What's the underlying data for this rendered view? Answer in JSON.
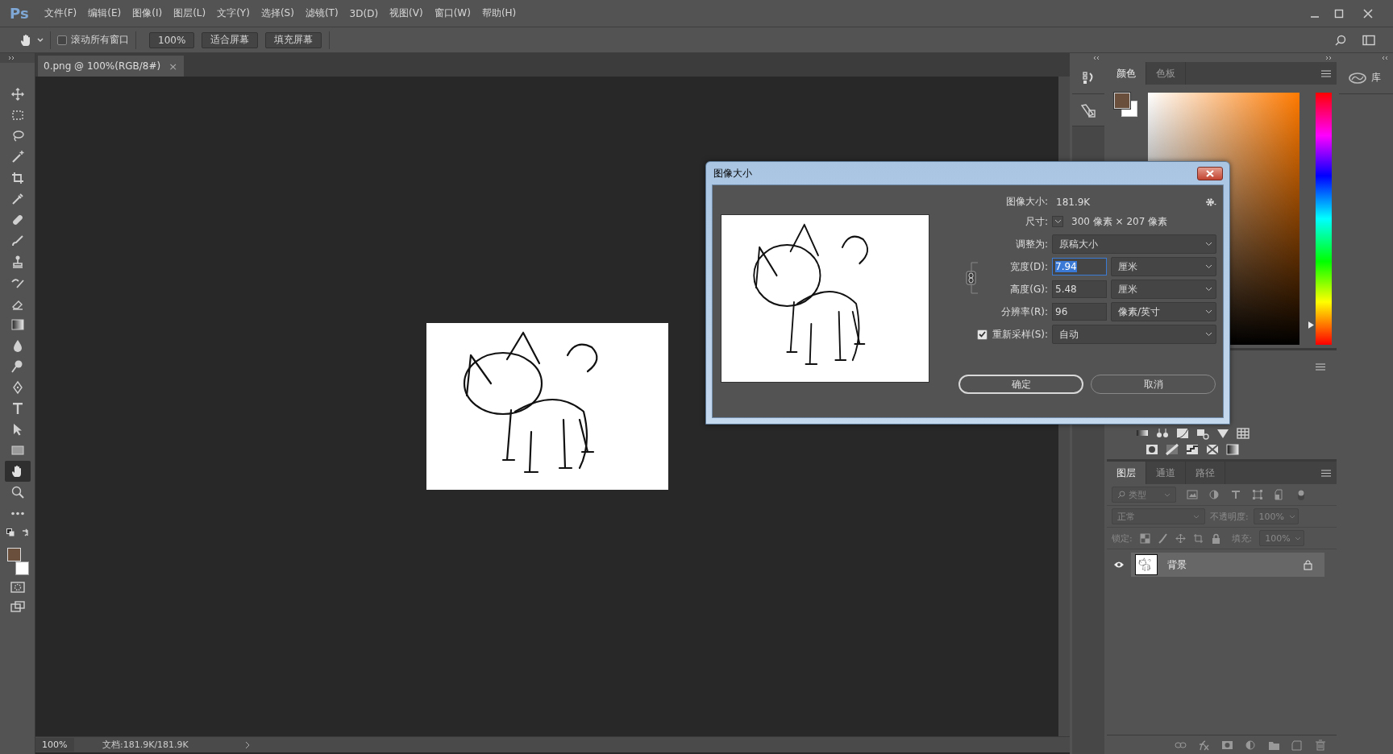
{
  "app": {
    "logo": "Ps"
  },
  "menu": [
    {
      "label": "文件(F)"
    },
    {
      "label": "编辑(E)"
    },
    {
      "label": "图像(I)"
    },
    {
      "label": "图层(L)"
    },
    {
      "label": "文字(Y)"
    },
    {
      "label": "选择(S)"
    },
    {
      "label": "滤镜(T)"
    },
    {
      "label": "3D(D)"
    },
    {
      "label": "视图(V)"
    },
    {
      "label": "窗口(W)"
    },
    {
      "label": "帮助(H)"
    }
  ],
  "options_bar": {
    "scroll_all_windows": {
      "label": "滚动所有窗口",
      "checked": false
    },
    "buttons": [
      {
        "label": "100%"
      },
      {
        "label": "适合屏幕"
      },
      {
        "label": "填充屏幕"
      }
    ]
  },
  "tools": [
    {
      "kind": "move",
      "selected": false
    },
    {
      "kind": "marquee",
      "selected": false
    },
    {
      "kind": "lasso",
      "selected": false
    },
    {
      "kind": "wand",
      "selected": false
    },
    {
      "kind": "crop",
      "selected": false
    },
    {
      "kind": "eyedropper",
      "selected": false
    },
    {
      "kind": "bandage",
      "selected": false
    },
    {
      "kind": "brush",
      "selected": false
    },
    {
      "kind": "stamp",
      "selected": false
    },
    {
      "kind": "history",
      "selected": false
    },
    {
      "kind": "eraser",
      "selected": false
    },
    {
      "kind": "gradient",
      "selected": false
    },
    {
      "kind": "drop",
      "selected": false
    },
    {
      "kind": "dodge",
      "selected": false
    },
    {
      "kind": "pen",
      "selected": false
    },
    {
      "kind": "type",
      "selected": false
    },
    {
      "kind": "pointer",
      "selected": false
    },
    {
      "kind": "rectangle",
      "selected": false
    },
    {
      "kind": "hand",
      "selected": true
    },
    {
      "kind": "zoom",
      "selected": false
    },
    {
      "kind": "more",
      "selected": false
    }
  ],
  "swatches": [
    {
      "kind": "foreground",
      "color": "#6a4f3c"
    },
    {
      "kind": "background",
      "color": "#ffffff"
    }
  ],
  "document": {
    "tab": {
      "title": "0.png @ 100%(RGB/8#)",
      "close": "×"
    }
  },
  "status_bar": {
    "zoom": "100%",
    "document_size": "文档:181.9K/181.9K"
  },
  "color_panel": {
    "tabs": [
      {
        "label": "颜色",
        "selected": true
      },
      {
        "label": "色板",
        "selected": false
      }
    ],
    "hue_slider": {
      "level": 0.08
    }
  },
  "library_panel": {
    "label": "库"
  },
  "layers_panel": {
    "tabs": [
      {
        "label": "图层",
        "selected": true
      },
      {
        "label": "通道",
        "selected": false
      },
      {
        "label": "路径",
        "selected": false
      }
    ],
    "filter": {
      "placeholder": "类型"
    },
    "blend_mode": "正常",
    "opacity": {
      "label": "不透明度:",
      "value": "100%"
    },
    "lock": {
      "label": "锁定:"
    },
    "fill": {
      "label": "填充:",
      "value": "100%"
    },
    "layers": [
      {
        "name": "背景",
        "visible": true,
        "locked": true,
        "selected": true
      }
    ]
  },
  "dialog": {
    "title": "图像大小",
    "image_size": {
      "label": "图像大小:",
      "value": "181.9K"
    },
    "dimensions": {
      "label": "尺寸:",
      "value": "300 像素 × 207 像素"
    },
    "fit_to": {
      "label": "调整为:",
      "value": "原稿大小"
    },
    "fields": [
      {
        "label": "宽度(D):",
        "value": "7.94",
        "unit": "厘米",
        "selected": true
      },
      {
        "label": "高度(G):",
        "value": "5.48",
        "unit": "厘米",
        "selected": false
      },
      {
        "label": "分辨率(R):",
        "value": "96",
        "unit": "像素/英寸",
        "selected": false
      }
    ],
    "constrain_proportions": {
      "on": true
    },
    "resample": {
      "label": "重新采样(S):",
      "checked": true,
      "value": "自动"
    },
    "buttons": [
      {
        "label": "确定",
        "kind": "default"
      },
      {
        "label": "取消",
        "kind": "normal"
      }
    ]
  }
}
